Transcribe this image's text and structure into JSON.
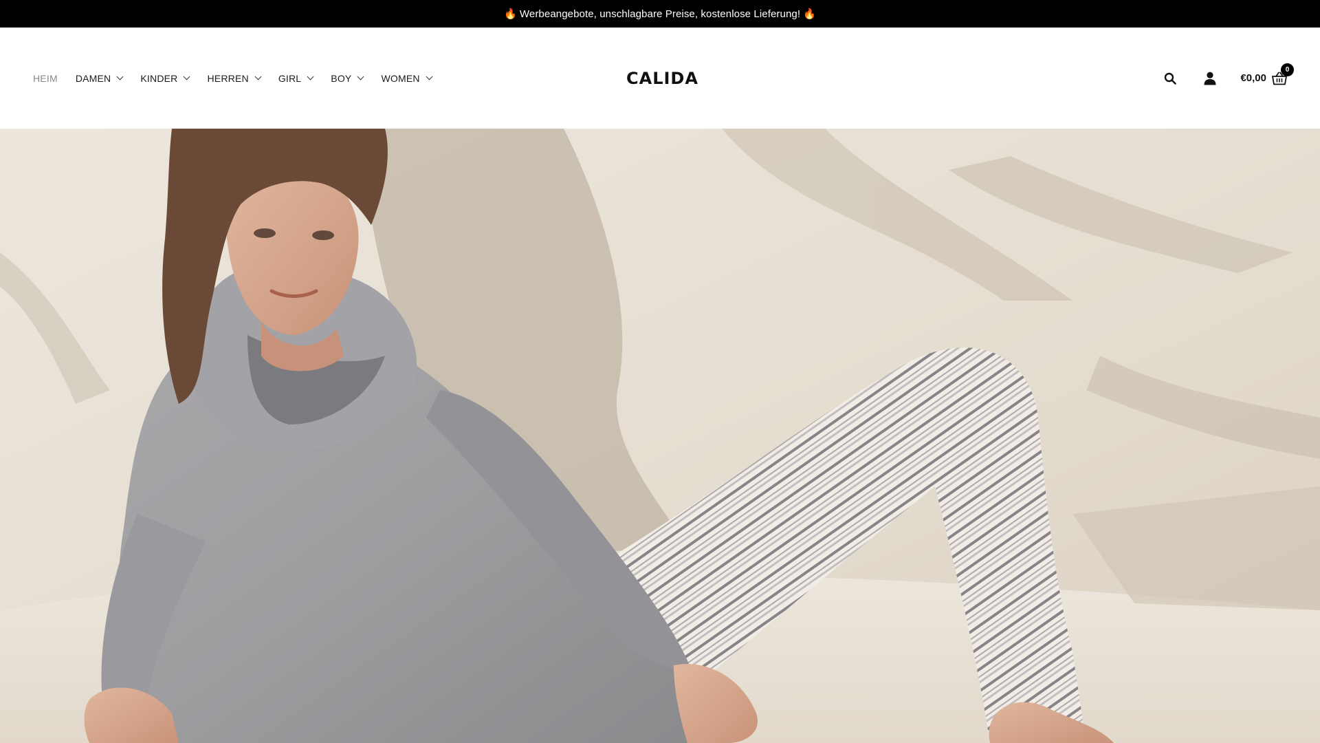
{
  "announcement": {
    "text": "Werbeangebote, unschlagbare Preise, kostenlose Lieferung!",
    "icon": "fire-icon",
    "icon_color": "#ff6a13"
  },
  "nav": {
    "items": [
      {
        "label": "HEIM",
        "active": true,
        "has_dropdown": false
      },
      {
        "label": "DAMEN",
        "active": false,
        "has_dropdown": true
      },
      {
        "label": "KINDER",
        "active": false,
        "has_dropdown": true
      },
      {
        "label": "HERREN",
        "active": false,
        "has_dropdown": true
      },
      {
        "label": "GIRL",
        "active": false,
        "has_dropdown": true
      },
      {
        "label": "BOY",
        "active": false,
        "has_dropdown": true
      },
      {
        "label": "WOMEN",
        "active": false,
        "has_dropdown": true
      }
    ]
  },
  "logo": {
    "text": "CALIDA"
  },
  "actions": {
    "search_icon": "search-icon",
    "account_icon": "user-icon",
    "cart_total": "€0,00",
    "cart_count": "0",
    "cart_icon": "basket-icon"
  },
  "hero": {
    "image": "model in grey hoodie and printed lounge pants reclining against a wall",
    "background_color": "#e6dfd4"
  },
  "colors": {
    "announcement_bg": "#000000",
    "announcement_text": "#ffffff",
    "nav_active": "#8a8a8a",
    "nav_default": "#1a1a1a"
  }
}
